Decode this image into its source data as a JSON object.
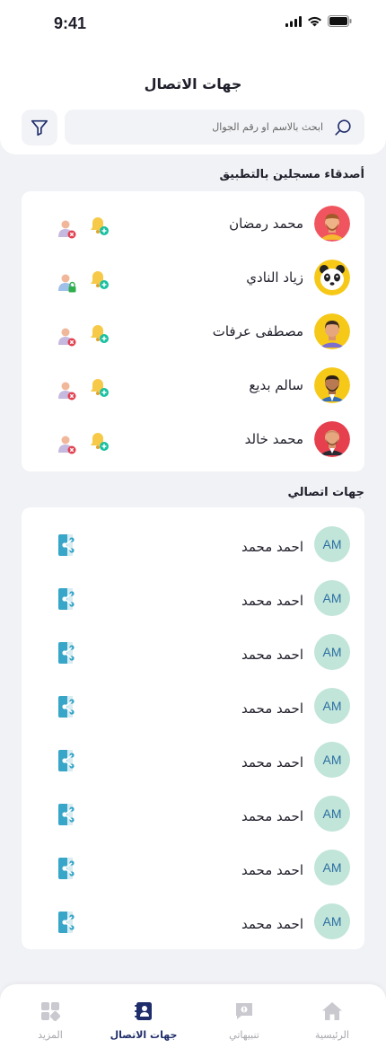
{
  "status_bar": {
    "time": "9:41"
  },
  "header": {
    "title": "جهات الاتصال"
  },
  "search": {
    "placeholder": "ابحث بالاسم او رقم الجوال"
  },
  "registered": {
    "title": "أصدقاء مسجلين بالتطبيق",
    "items": [
      {
        "name": "محمد رمضان"
      },
      {
        "name": "زياد النادي"
      },
      {
        "name": "مصطفى عرفات"
      },
      {
        "name": "سالم بديع"
      },
      {
        "name": "محمد خالد"
      }
    ]
  },
  "contacts": {
    "title": "جهات اتصالي",
    "items": [
      {
        "initials": "AM",
        "name": "احمد محمد"
      },
      {
        "initials": "AM",
        "name": "احمد محمد"
      },
      {
        "initials": "AM",
        "name": "احمد محمد"
      },
      {
        "initials": "AM",
        "name": "احمد محمد"
      },
      {
        "initials": "AM",
        "name": "احمد محمد"
      },
      {
        "initials": "AM",
        "name": "احمد محمد"
      },
      {
        "initials": "AM",
        "name": "احمد محمد"
      },
      {
        "initials": "AM",
        "name": "احمد محمد"
      }
    ]
  },
  "nav": {
    "home": "الرئيسية",
    "alerts": "تنبيهاتي",
    "contacts": "جهات الاتصال",
    "more": "المزيد"
  },
  "colors": {
    "accent": "#1f2d6b",
    "initials_bg": "#c1e5d8",
    "initials_fg": "#2d6fa3",
    "add": "#18c0a0",
    "remove": "#e2404f"
  }
}
